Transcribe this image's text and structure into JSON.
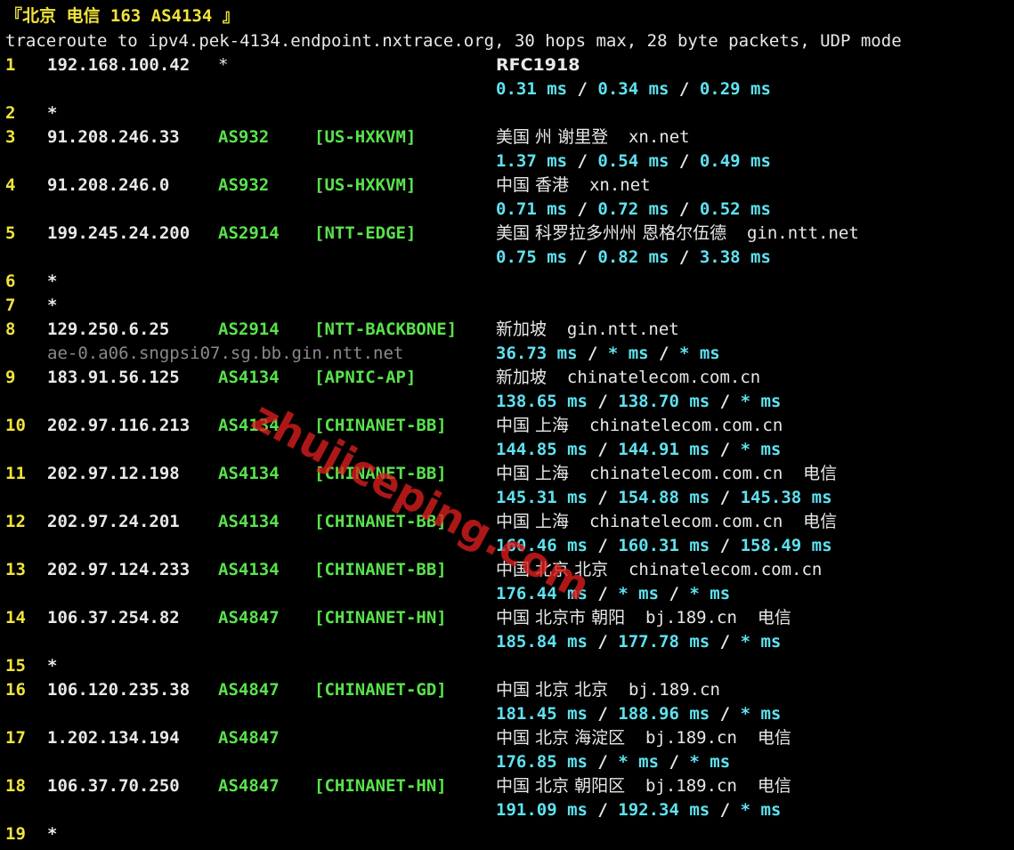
{
  "header": {
    "banner": "『北京 电信 163 AS4134 』",
    "traceroute_line": "traceroute to ipv4.pek-4134.endpoint.nxtrace.org, 30 hops max, 28 byte packets, UDP mode"
  },
  "hops": [
    {
      "hop": "1",
      "ip": "192.168.100.42",
      "asn": "*",
      "tag": "",
      "geo": "RFC1918",
      "host": "",
      "isp": "",
      "rtt": [
        "0.31 ms",
        "0.34 ms",
        "0.29 ms"
      ]
    },
    {
      "hop": "2",
      "ip": "*"
    },
    {
      "hop": "3",
      "ip": "91.208.246.33",
      "asn": "AS932",
      "tag": "[US-HXKVM]",
      "geo": "美国 州 谢里登",
      "host": "xn.net",
      "isp": "",
      "rtt": [
        "1.37 ms",
        "0.54 ms",
        "0.49 ms"
      ]
    },
    {
      "hop": "4",
      "ip": "91.208.246.0",
      "asn": "AS932",
      "tag": "[US-HXKVM]",
      "geo": "中国 香港",
      "host": "xn.net",
      "isp": "",
      "rtt": [
        "0.71 ms",
        "0.72 ms",
        "0.52 ms"
      ]
    },
    {
      "hop": "5",
      "ip": "199.245.24.200",
      "asn": "AS2914",
      "tag": "[NTT-EDGE]",
      "geo": "美国 科罗拉多州州 恩格尔伍德",
      "host": "gin.ntt.net",
      "isp": "",
      "rtt": [
        "0.75 ms",
        "0.82 ms",
        "3.38 ms"
      ]
    },
    {
      "hop": "6",
      "ip": "*"
    },
    {
      "hop": "7",
      "ip": "*"
    },
    {
      "hop": "8",
      "ip": "129.250.6.25",
      "asn": "AS2914",
      "tag": "[NTT-BACKBONE]",
      "geo": "新加坡",
      "host": "gin.ntt.net",
      "isp": "",
      "rdns": "ae-0.a06.sngpsi07.sg.bb.gin.ntt.net",
      "rtt": [
        "36.73 ms",
        "* ms",
        "* ms"
      ]
    },
    {
      "hop": "9",
      "ip": "183.91.56.125",
      "asn": "AS4134",
      "tag": "[APNIC-AP]",
      "geo": "新加坡",
      "host": "chinatelecom.com.cn",
      "isp": "",
      "rtt": [
        "138.65 ms",
        "138.70 ms",
        "* ms"
      ]
    },
    {
      "hop": "10",
      "ip": "202.97.116.213",
      "asn": "AS4134",
      "tag": "[CHINANET-BB]",
      "geo": "中国 上海",
      "host": "chinatelecom.com.cn",
      "isp": "",
      "rtt": [
        "144.85 ms",
        "144.91 ms",
        "* ms"
      ]
    },
    {
      "hop": "11",
      "ip": "202.97.12.198",
      "asn": "AS4134",
      "tag": "[CHINANET-BB]",
      "geo": "中国 上海",
      "host": "chinatelecom.com.cn",
      "isp": "电信",
      "rtt": [
        "145.31 ms",
        "154.88 ms",
        "145.38 ms"
      ]
    },
    {
      "hop": "12",
      "ip": "202.97.24.201",
      "asn": "AS4134",
      "tag": "[CHINANET-BB]",
      "geo": "中国 上海",
      "host": "chinatelecom.com.cn",
      "isp": "电信",
      "rtt": [
        "160.46 ms",
        "160.31 ms",
        "158.49 ms"
      ]
    },
    {
      "hop": "13",
      "ip": "202.97.124.233",
      "asn": "AS4134",
      "tag": "[CHINANET-BB]",
      "geo": "中国 北京 北京",
      "host": "chinatelecom.com.cn",
      "isp": "",
      "rtt": [
        "176.44 ms",
        "* ms",
        "* ms"
      ]
    },
    {
      "hop": "14",
      "ip": "106.37.254.82",
      "asn": "AS4847",
      "tag": "[CHINANET-HN]",
      "geo": "中国 北京市 朝阳",
      "host": "bj.189.cn",
      "isp": "电信",
      "rtt": [
        "185.84 ms",
        "177.78 ms",
        "* ms"
      ]
    },
    {
      "hop": "15",
      "ip": "*"
    },
    {
      "hop": "16",
      "ip": "106.120.235.38",
      "asn": "AS4847",
      "tag": "[CHINANET-GD]",
      "geo": "中国 北京 北京",
      "host": "bj.189.cn",
      "isp": "",
      "rtt": [
        "181.45 ms",
        "188.96 ms",
        "* ms"
      ]
    },
    {
      "hop": "17",
      "ip": "1.202.134.194",
      "asn": "AS4847",
      "tag": "",
      "geo": "中国 北京 海淀区",
      "host": "bj.189.cn",
      "isp": "电信",
      "rtt": [
        "176.85 ms",
        "* ms",
        "* ms"
      ]
    },
    {
      "hop": "18",
      "ip": "106.37.70.250",
      "asn": "AS4847",
      "tag": "[CHINANET-HN]",
      "geo": "中国 北京 朝阳区",
      "host": "bj.189.cn",
      "isp": "电信",
      "rtt": [
        "191.09 ms",
        "192.34 ms",
        "* ms"
      ]
    },
    {
      "hop": "19",
      "ip": "*"
    }
  ],
  "watermark": "zhujiceping.com",
  "colors": {
    "background": "#000000",
    "hop_number": "#f0e43c",
    "asn": "#59e24c",
    "rtt": "#5ee2f0",
    "watermark": "#dc1e1e"
  }
}
